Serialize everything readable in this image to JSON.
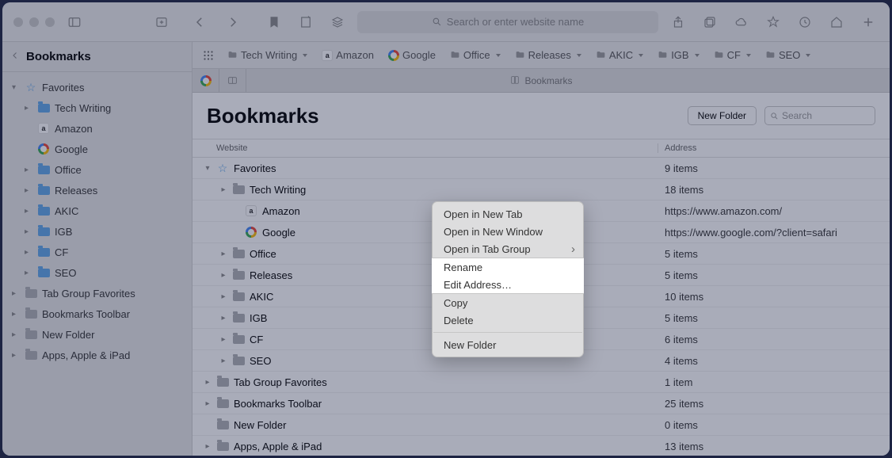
{
  "toolbar": {
    "address_placeholder": "Search or enter website name"
  },
  "favbar": {
    "items": [
      {
        "label": "Tech Writing",
        "type": "folder",
        "chev": true
      },
      {
        "label": "Amazon",
        "type": "amz"
      },
      {
        "label": "Google",
        "type": "goog"
      },
      {
        "label": "Office",
        "type": "folder",
        "chev": true
      },
      {
        "label": "Releases",
        "type": "folder",
        "chev": true
      },
      {
        "label": "AKIC",
        "type": "folder",
        "chev": true
      },
      {
        "label": "IGB",
        "type": "folder",
        "chev": true
      },
      {
        "label": "CF",
        "type": "folder",
        "chev": true
      },
      {
        "label": "SEO",
        "type": "folder",
        "chev": true
      }
    ]
  },
  "tabstrip": {
    "title": "Bookmarks"
  },
  "sidebar": {
    "title": "Bookmarks",
    "items": [
      {
        "label": "Favorites",
        "icon": "star",
        "disc": "down",
        "indent": 0
      },
      {
        "label": "Tech Writing",
        "icon": "folder",
        "disc": "right",
        "indent": 1
      },
      {
        "label": "Amazon",
        "icon": "amz",
        "disc": "",
        "indent": 1
      },
      {
        "label": "Google",
        "icon": "goog",
        "disc": "",
        "indent": 1
      },
      {
        "label": "Office",
        "icon": "folder",
        "disc": "right",
        "indent": 1
      },
      {
        "label": "Releases",
        "icon": "folder",
        "disc": "right",
        "indent": 1
      },
      {
        "label": "AKIC",
        "icon": "folder",
        "disc": "right",
        "indent": 1
      },
      {
        "label": "IGB",
        "icon": "folder",
        "disc": "right",
        "indent": 1
      },
      {
        "label": "CF",
        "icon": "folder",
        "disc": "right",
        "indent": 1
      },
      {
        "label": "SEO",
        "icon": "folder",
        "disc": "right",
        "indent": 1
      },
      {
        "label": "Tab Group Favorites",
        "icon": "folder-gray",
        "disc": "right",
        "indent": 0
      },
      {
        "label": "Bookmarks Toolbar",
        "icon": "folder-gray",
        "disc": "right",
        "indent": 0
      },
      {
        "label": "New Folder",
        "icon": "folder-gray",
        "disc": "right",
        "indent": 0
      },
      {
        "label": "Apps, Apple & iPad",
        "icon": "folder-gray",
        "disc": "right",
        "indent": 0
      }
    ]
  },
  "main": {
    "title": "Bookmarks",
    "new_folder_btn": "New Folder",
    "search_placeholder": "Search",
    "col_website": "Website",
    "col_address": "Address",
    "rows": [
      {
        "label": "Favorites",
        "icon": "star",
        "disc": "down",
        "pad": 0,
        "addr": "9 items"
      },
      {
        "label": "Tech Writing",
        "icon": "folder-gray",
        "disc": "right",
        "pad": 1,
        "addr": "18 items"
      },
      {
        "label": "Amazon",
        "icon": "amz",
        "disc": "",
        "pad": 2,
        "addr": "https://www.amazon.com/",
        "sel": true
      },
      {
        "label": "Google",
        "icon": "goog",
        "disc": "",
        "pad": 2,
        "addr": "https://www.google.com/?client=safari"
      },
      {
        "label": "Office",
        "icon": "folder-gray",
        "disc": "right",
        "pad": 1,
        "addr": "5 items"
      },
      {
        "label": "Releases",
        "icon": "folder-gray",
        "disc": "right",
        "pad": 1,
        "addr": "5 items"
      },
      {
        "label": "AKIC",
        "icon": "folder-gray",
        "disc": "right",
        "pad": 1,
        "addr": "10 items"
      },
      {
        "label": "IGB",
        "icon": "folder-gray",
        "disc": "right",
        "pad": 1,
        "addr": "5 items"
      },
      {
        "label": "CF",
        "icon": "folder-gray",
        "disc": "right",
        "pad": 1,
        "addr": "6 items"
      },
      {
        "label": "SEO",
        "icon": "folder-gray",
        "disc": "right",
        "pad": 1,
        "addr": "4 items"
      },
      {
        "label": "Tab Group Favorites",
        "icon": "folder-gray",
        "disc": "right",
        "pad": 0,
        "addr": "1 item"
      },
      {
        "label": "Bookmarks Toolbar",
        "icon": "folder-gray",
        "disc": "right",
        "pad": 0,
        "addr": "25 items"
      },
      {
        "label": "New Folder",
        "icon": "folder-gray",
        "disc": "",
        "pad": 0,
        "addr": "0 items"
      },
      {
        "label": "Apps, Apple & iPad",
        "icon": "folder-gray",
        "disc": "right",
        "pad": 0,
        "addr": "13 items"
      }
    ]
  },
  "ctx": {
    "open_new_tab": "Open in New Tab",
    "open_new_window": "Open in New Window",
    "open_tab_group": "Open in Tab Group",
    "rename": "Rename",
    "edit_address": "Edit Address…",
    "copy": "Copy",
    "delete": "Delete",
    "new_folder": "New Folder"
  }
}
